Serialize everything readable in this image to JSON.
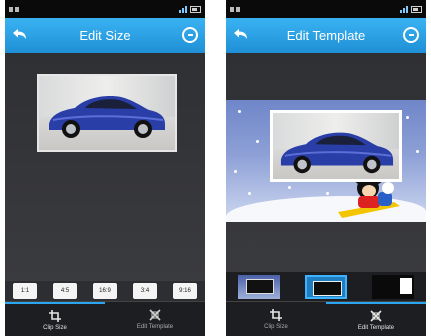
{
  "left_screen": {
    "title": "Edit Size",
    "ratios": [
      "1:1",
      "4:5",
      "16:9",
      "3:4",
      "9:16"
    ],
    "tabs": [
      "Clip Size",
      "Edit Template"
    ]
  },
  "right_screen": {
    "title": "Edit Template",
    "tabs": [
      "Clip Size",
      "Edit Template"
    ],
    "templates": [
      "template-1",
      "template-2",
      "template-3"
    ],
    "selected_template": "template-2"
  },
  "colors": {
    "title_bar": "#2aa0e8",
    "accent": "#3fb2ff",
    "background": "#2b2d31",
    "car": "#2a3ea8"
  }
}
